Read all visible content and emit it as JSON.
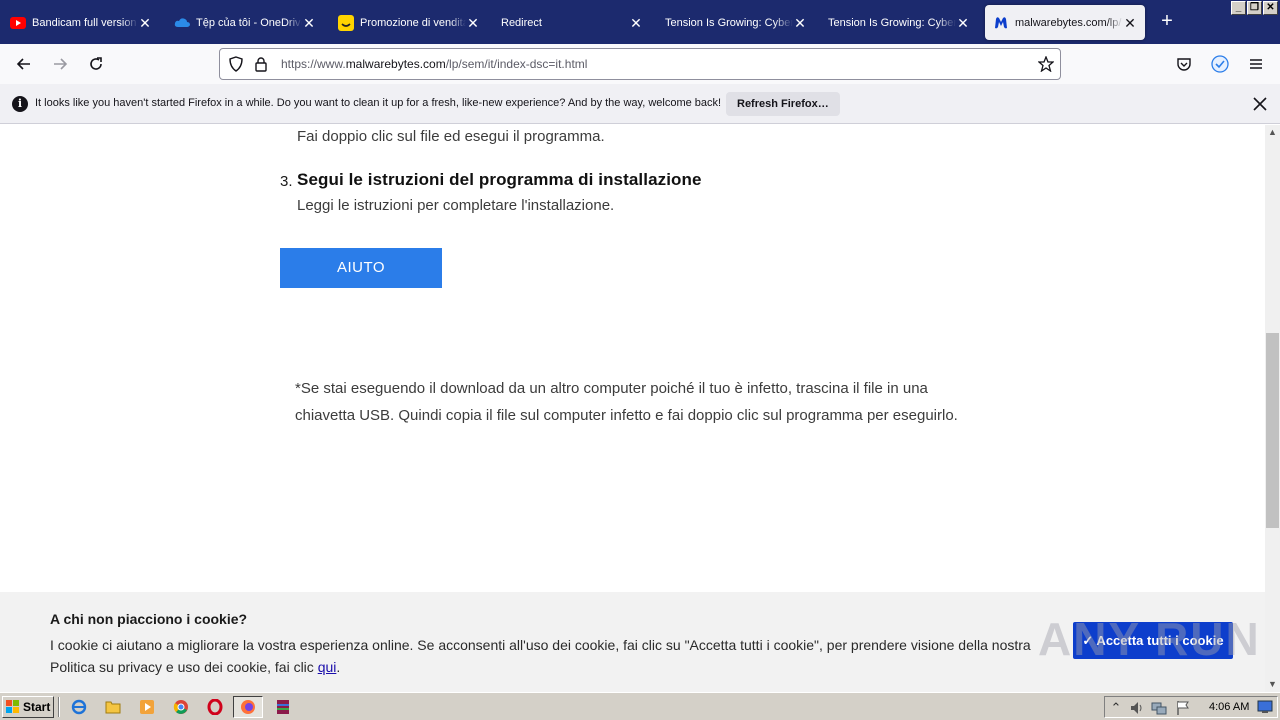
{
  "tabs": [
    {
      "title": "Bandicam full version f",
      "icon": "youtube-icon",
      "active": false
    },
    {
      "title": "Tệp của tôi - OneDrive",
      "icon": "onedrive-icon",
      "active": false
    },
    {
      "title": "Promozione di vendita",
      "icon": "smiley-icon",
      "active": false
    },
    {
      "title": "Redirect",
      "icon": "none",
      "active": false
    },
    {
      "title": "Tension Is Growing: Cyber",
      "icon": "none",
      "active": false
    },
    {
      "title": "Tension Is Growing: Cyber",
      "icon": "none",
      "active": false
    },
    {
      "title": "malwarebytes.com/lp/",
      "icon": "malwarebytes-icon",
      "active": true
    }
  ],
  "close_glyph": "✕",
  "newtab_glyph": "+",
  "url": {
    "prefix": "https://www.",
    "domain": "malwarebytes.com",
    "path": "/lp/sem/it/index-dsc=it.html"
  },
  "notification": {
    "message": "It looks like you haven't started Firefox in a while. Do you want to clean it up for a fresh, like-new experience? And by the way, welcome back!",
    "button": "Refresh Firefox…",
    "info_glyph": "i"
  },
  "content": {
    "step2_desc": "Fai doppio clic sul file ed esegui il programma.",
    "step3_num": "3.",
    "step3_title": "Segui le istruzioni del programma di installazione",
    "step3_desc": "Leggi le istruzioni per completare l'installazione.",
    "help_button": "AIUTO",
    "note": "*Se stai eseguendo il download da un altro computer poiché il tuo è infetto, trascina il file in una chiavetta USB. Quindi copia il file sul computer infetto e fai doppio clic sul programma per eseguirlo."
  },
  "cookie": {
    "title": "A chi non piacciono i cookie?",
    "text": "I cookie ci aiutano a migliorare la vostra esperienza online. Se acconsenti all'uso dei cookie, fai clic su \"Accetta tutti i cookie\", per prendere visione della nostra Politica su privacy e uso dei cookie, fai clic ",
    "link": "qui",
    "text_end": ".",
    "accept_button": "✓ Accetta tutti i cookie"
  },
  "watermark": "ANY RUN",
  "taskbar": {
    "start": "Start",
    "clock": "4:06 AM"
  },
  "colors": {
    "tabbar": "#1c2a6e",
    "help_button": "#2b7de9",
    "cookie_button": "#0d3ecc"
  }
}
